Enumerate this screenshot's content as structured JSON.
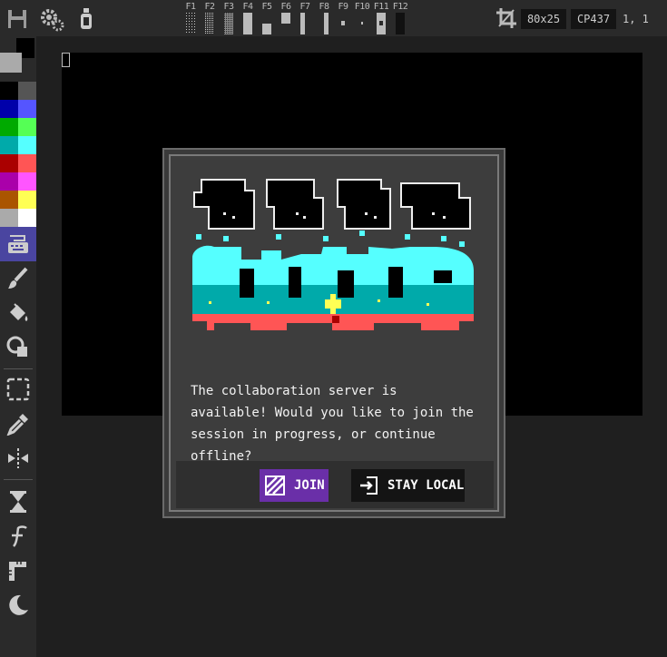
{
  "toolbar": {
    "icons": [
      "save-icon",
      "settings-gear-icon",
      "paint-bottle-icon"
    ],
    "function_keys": [
      "F1",
      "F2",
      "F3",
      "F4",
      "F5",
      "F6",
      "F7",
      "F8",
      "F9",
      "F10",
      "F11",
      "F12"
    ],
    "crop_icon": "crop-icon",
    "canvas_size": "80x25",
    "codepage": "CP437",
    "cursor_position": "1, 1"
  },
  "palette": {
    "foreground": "#aaaaaa",
    "background": "#000000",
    "colors": [
      [
        "#000000",
        "#555555"
      ],
      [
        "#0000aa",
        "#5555ff"
      ],
      [
        "#00aa00",
        "#55ff55"
      ],
      [
        "#00aaaa",
        "#55ffff"
      ],
      [
        "#aa0000",
        "#ff5555"
      ],
      [
        "#aa00aa",
        "#ff55ff"
      ],
      [
        "#aa5500",
        "#ffff55"
      ],
      [
        "#aaaaaa",
        "#ffffff"
      ]
    ]
  },
  "tools": [
    {
      "name": "keyboard-icon",
      "active": true
    },
    {
      "name": "brush-icon",
      "active": false
    },
    {
      "name": "fill-bucket-icon",
      "active": false
    },
    {
      "name": "shapes-icon",
      "active": false
    },
    {
      "name": "selection-icon",
      "active": false
    },
    {
      "name": "eyedropper-icon",
      "active": false
    },
    {
      "name": "mirror-icon",
      "active": false
    },
    {
      "name": "hourglass-icon",
      "active": false
    },
    {
      "name": "font-icon",
      "active": false
    },
    {
      "name": "ruler-icon",
      "active": false
    },
    {
      "name": "moon-icon",
      "active": false
    }
  ],
  "dialog": {
    "message": "The collaboration server is available! Would you like to join the session in progress, or continue offline?",
    "join_label": "JOIN",
    "stay_local_label": "STAY LOCAL"
  },
  "colors": {
    "join_button": "#6a2fa8",
    "stay_local_button": "#141414",
    "active_tool": "#4a45a0",
    "logo_cyan": "#55ffff",
    "logo_teal": "#00aaaa",
    "logo_red": "#ff5555"
  }
}
